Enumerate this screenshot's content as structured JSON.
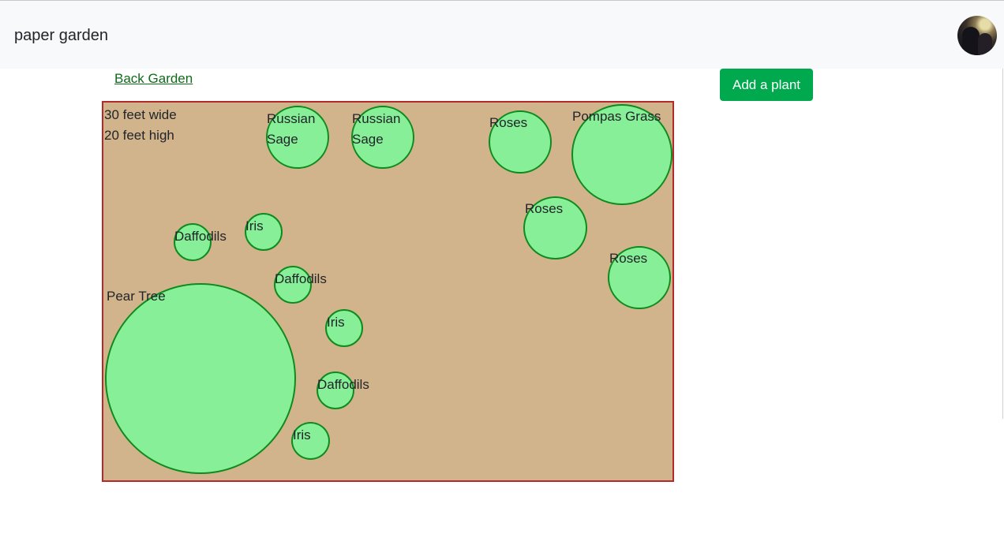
{
  "navbar": {
    "brand": "paper garden",
    "avatar_icon": "user-avatar-icon"
  },
  "breadcrumb": {
    "back_label": "Back Garden"
  },
  "actions": {
    "add_plant_label": "Add a plant"
  },
  "garden": {
    "width_text": "30 feet wide",
    "height_text": "20 feet high",
    "colors": {
      "soil": "#d2b48c",
      "border": "#b22a2a",
      "plant_fill": "#86ef97",
      "plant_stroke": "#0f8a1f"
    },
    "plants": [
      {
        "name": "Russian Sage"
      },
      {
        "name": "Russian Sage"
      },
      {
        "name": "Roses"
      },
      {
        "name": "Pompas Grass"
      },
      {
        "name": "Roses"
      },
      {
        "name": "Daffodils"
      },
      {
        "name": "Iris"
      },
      {
        "name": "Roses"
      },
      {
        "name": "Daffodils"
      },
      {
        "name": "Pear Tree"
      },
      {
        "name": "Iris"
      },
      {
        "name": "Daffodils"
      },
      {
        "name": "Iris"
      }
    ]
  }
}
